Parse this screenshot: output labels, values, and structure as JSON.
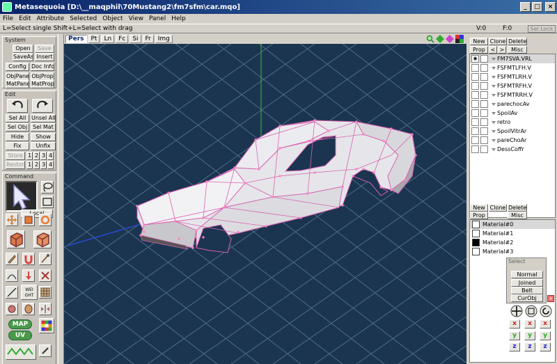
{
  "window": {
    "title": "Metasequoia [D:\\__maqphil\\70Mustang2\\fm7sfm\\car.mqo]"
  },
  "menu": [
    "File",
    "Edit",
    "Attribute",
    "Selected",
    "Object",
    "View",
    "Panel",
    "Help"
  ],
  "hint": "L=Select single  Shift+L=Select with drag",
  "status": {
    "vertices": "V:0",
    "faces": "F:0",
    "sel_lock": "Sel Lock"
  },
  "system": {
    "header": "System",
    "open": "Open",
    "save": "Save",
    "saveas": "SaveAs",
    "insert": "Insert",
    "config": "Config",
    "docinfo": "Doc Info",
    "objpanel": "ObjPanel",
    "objprop": "ObjProp",
    "matpanel": "MatPanel",
    "matprop": "MatProp"
  },
  "edit": {
    "header": "Edit",
    "selall": "Sel All",
    "unselall": "Unsel All",
    "selobj": "Sel Obj",
    "selmat": "Sel Mat",
    "hide": "Hide",
    "show": "Show",
    "fix": "Fix",
    "unfix": "Unfix",
    "store": "Store",
    "restore": "Restore",
    "slots": [
      "1",
      "2",
      "3",
      "4"
    ]
  },
  "command": {
    "header": "Command",
    "local": "Local",
    "map": "MAP",
    "uv": "UV",
    "weight": "WEI GHT"
  },
  "view": {
    "tabs": [
      "Pers",
      "Pt",
      "Ln",
      "Fc",
      "Si",
      "Fr",
      "Img"
    ],
    "active_tab": "Pers"
  },
  "objects": {
    "buttons": {
      "new": "New",
      "clone": "Clone",
      "delete": "Delete",
      "prop": "Prop",
      "up": "<",
      "down": ">",
      "misc": "Misc"
    },
    "items": [
      {
        "name": "FM7SVA.VRL",
        "selected": true
      },
      {
        "name": "FSFMTLFH.V"
      },
      {
        "name": "FSFMTLRH.V"
      },
      {
        "name": "FSFMTRFH.V"
      },
      {
        "name": "FSFMTRRH.V"
      },
      {
        "name": "parechocAv"
      },
      {
        "name": "SpoilAv"
      },
      {
        "name": "retro"
      },
      {
        "name": "SpoilVitrAr"
      },
      {
        "name": "pareChoAr"
      },
      {
        "name": "DessCoffr"
      }
    ]
  },
  "materials": {
    "buttons": {
      "new": "New",
      "clone": "Clone",
      "delete": "Delete",
      "prop": "Prop",
      "misc": "Misc"
    },
    "items": [
      {
        "name": "Material#0",
        "color": "#ffffff",
        "selected": true
      },
      {
        "name": "Material#1",
        "color": "#ffffff"
      },
      {
        "name": "Material#2",
        "color": "#000000"
      },
      {
        "name": "Material#3",
        "color": "#ffffff"
      }
    ]
  },
  "select_panel": {
    "header": "Select",
    "normal": "Normal",
    "joined": "Joined face",
    "belt": "Belt",
    "curobj": "CurObj"
  },
  "axis": {
    "x": "x",
    "y": "y",
    "z": "z"
  },
  "colors": {
    "viewport": "#1b3550",
    "wire": "#e040a0",
    "grid": "#5d7a8f",
    "title": "#0a246a"
  }
}
